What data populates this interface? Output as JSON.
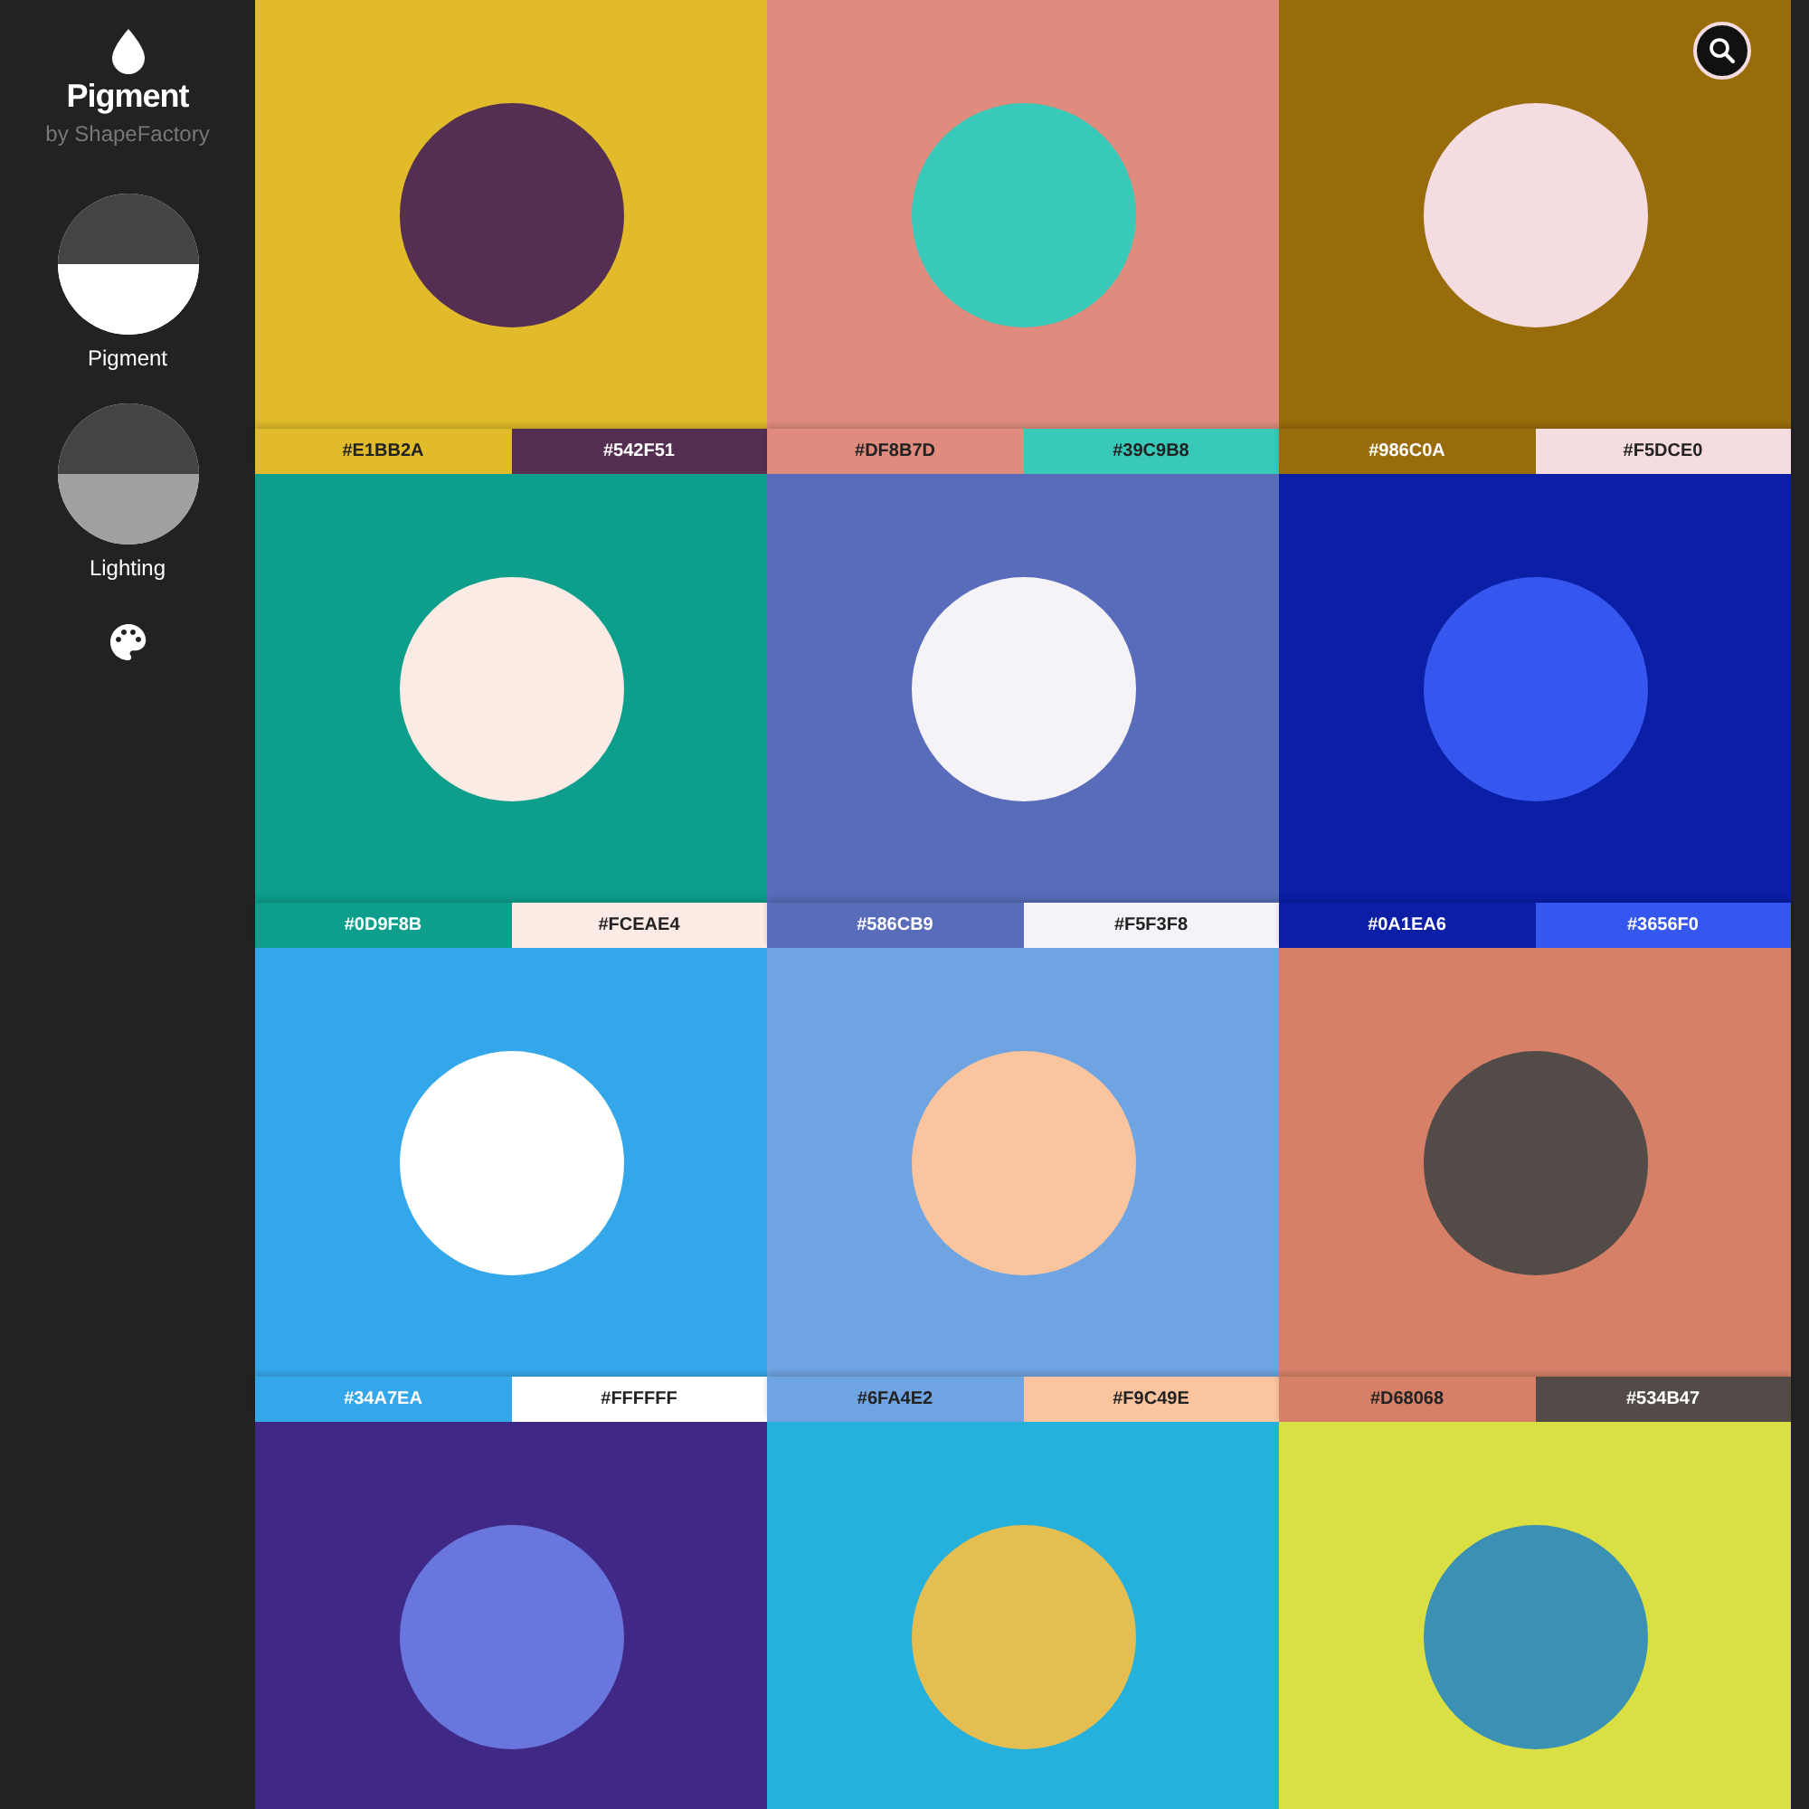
{
  "sidebar": {
    "app_name": "Pigment",
    "byline": "by ShapeFactory",
    "modes": [
      {
        "label": "Pigment",
        "color": "#ffffff"
      },
      {
        "label": "Lighting",
        "color": "#a0a0a0"
      }
    ]
  },
  "palettes": [
    {
      "swatches": [
        "#E1BB2A",
        "#542F51"
      ]
    },
    {
      "swatches": [
        "#DF8B7D",
        "#39C9B8"
      ]
    },
    {
      "swatches": [
        "#986C0A",
        "#F5DCE0"
      ]
    },
    {
      "swatches": [
        "#0D9F8B",
        "#FCEAE4"
      ]
    },
    {
      "swatches": [
        "#586CB9",
        "#F5F3F8"
      ]
    },
    {
      "swatches": [
        "#0A1EA6",
        "#3656F0"
      ]
    },
    {
      "swatches": [
        "#34A7EA",
        "#FFFFFF"
      ]
    },
    {
      "swatches": [
        "#6FA4E2",
        "#F9C49E"
      ]
    },
    {
      "swatches": [
        "#D68068",
        "#534B47"
      ]
    },
    {
      "tile": {
        "color": "#3f2886"
      },
      "circle": {
        "color": "#6876de"
      }
    },
    {
      "tile": {
        "color": "#26b0dc"
      },
      "circle": {
        "color": "#e4be50"
      }
    },
    {
      "tile": {
        "color": "#dae044"
      },
      "circle": {
        "color": "#3a91b4"
      }
    }
  ]
}
